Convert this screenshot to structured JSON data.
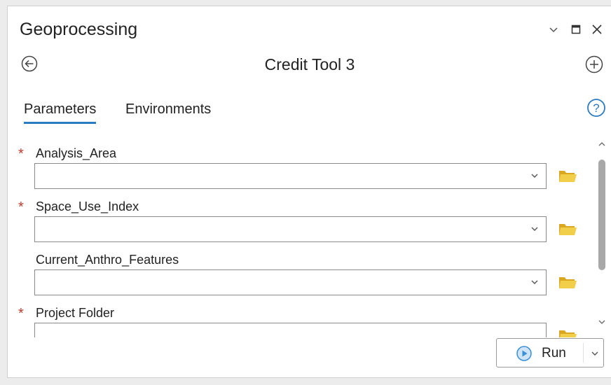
{
  "pane": {
    "title": "Geoprocessing",
    "tool_title": "Credit Tool 3"
  },
  "tabs": [
    {
      "label": "Parameters",
      "active": true
    },
    {
      "label": "Environments",
      "active": false
    }
  ],
  "parameters": [
    {
      "label": "Analysis_Area",
      "required": true,
      "value": ""
    },
    {
      "label": "Space_Use_Index",
      "required": true,
      "value": ""
    },
    {
      "label": "Current_Anthro_Features",
      "required": false,
      "value": ""
    },
    {
      "label": "Project Folder",
      "required": true,
      "value": ""
    }
  ],
  "required_marker": "*",
  "run_button": {
    "label": "Run"
  },
  "icons": {
    "minimize": "chevron-down-icon",
    "maximize": "maximize-icon",
    "close": "close-icon",
    "back": "back-arrow-icon",
    "add": "add-icon",
    "help": "help-icon",
    "browse": "folder-icon",
    "run": "play-icon"
  },
  "colors": {
    "accent": "#2b7bc3",
    "required": "#c0392b",
    "folder": "#e8c547",
    "run_icon": "#3a8fd8"
  }
}
